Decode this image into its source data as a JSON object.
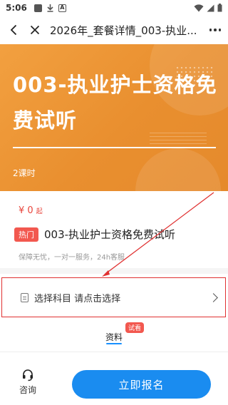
{
  "status_bar": {
    "time": "5:06"
  },
  "nav": {
    "title": "2026年_套餐详情_003-执业..."
  },
  "banner": {
    "title": "003-执业护士资格免费试听",
    "subtitle": "2课时"
  },
  "price": {
    "amount": "¥ 0",
    "unit": "起"
  },
  "course": {
    "hot_tag": "热门",
    "name": "003-执业护士资格免费试听",
    "guarantee": "保障无忧，一对一服务，24h客服"
  },
  "subject": {
    "label": "选择科目 请点击选择"
  },
  "tabs": {
    "materials": "资料",
    "trial_badge": "试看"
  },
  "bottom": {
    "consult_label": "咨询",
    "signup_label": "立即报名"
  },
  "colors": {
    "accent_blue": "#1a8cf0",
    "banner_orange": "#e98f2f",
    "price_red": "#e8453c",
    "annotation_red": "#e03131"
  }
}
